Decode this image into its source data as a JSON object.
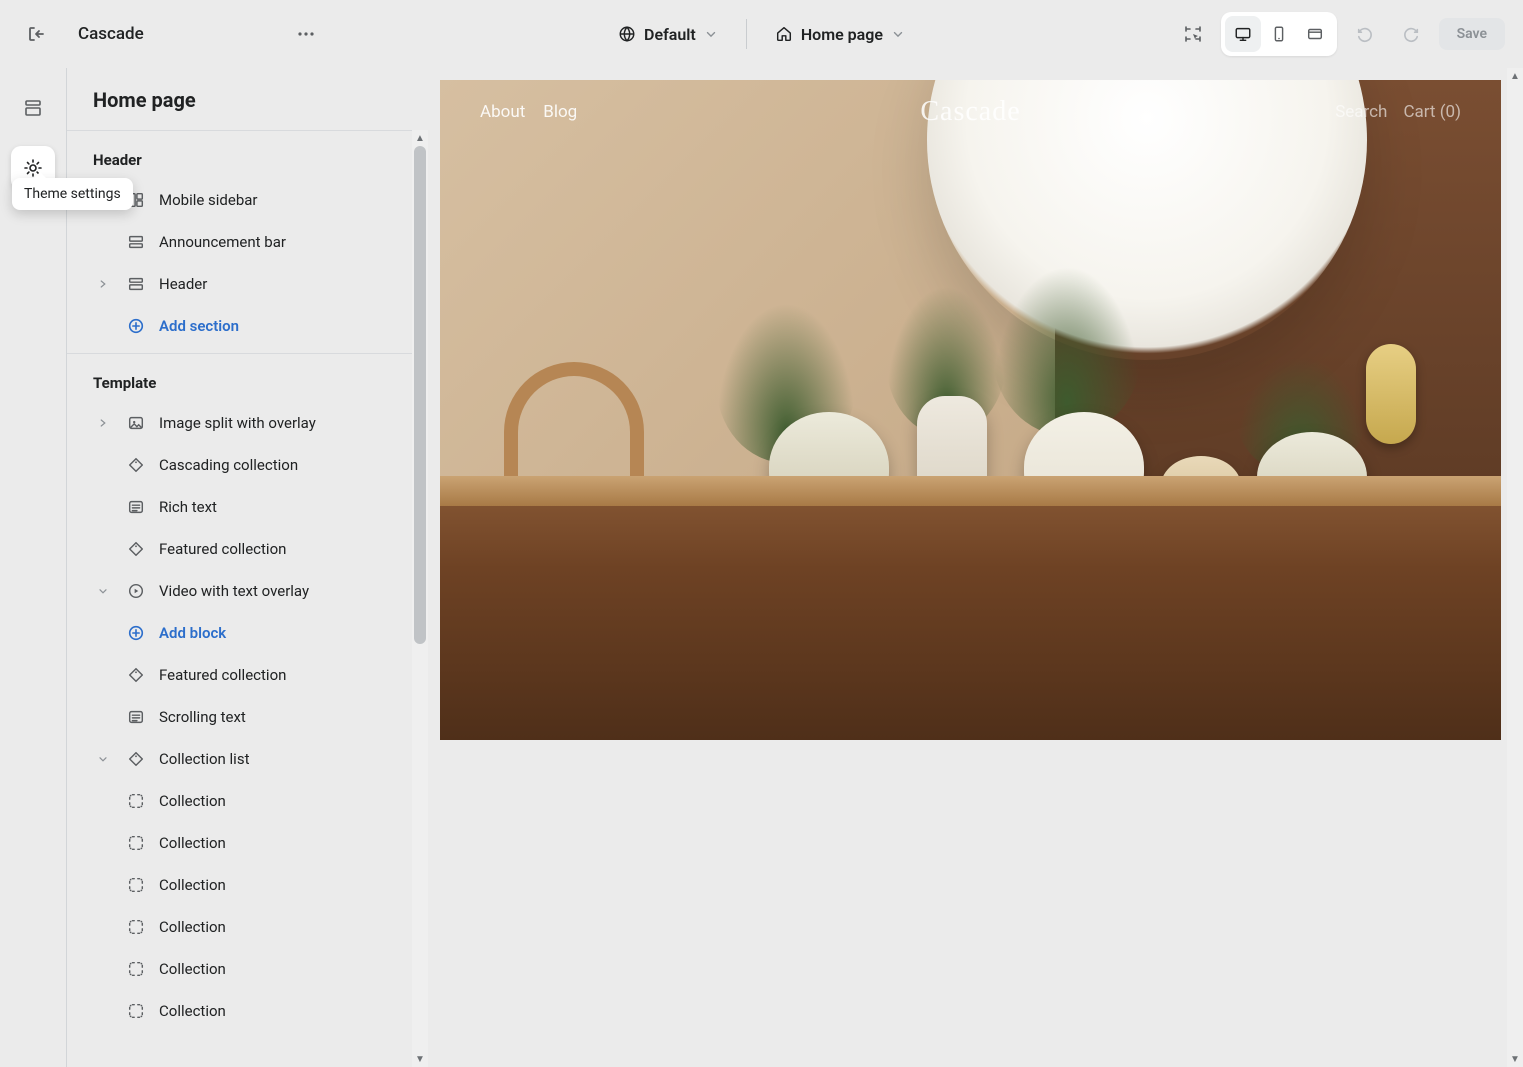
{
  "topbar": {
    "theme_name": "Cascade",
    "locale_label": "Default",
    "page_label": "Home page",
    "save_label": "Save"
  },
  "tooltip": {
    "theme_settings": "Theme settings"
  },
  "sidebar": {
    "title": "Home page",
    "groups": [
      {
        "heading": "Header",
        "rows": [
          {
            "label": "Mobile sidebar",
            "icon": "layout",
            "chevron": "none",
            "indent": false
          },
          {
            "label": "Announcement bar",
            "icon": "announcement",
            "chevron": "none",
            "indent": false
          },
          {
            "label": "Header",
            "icon": "header",
            "chevron": "right",
            "indent": false
          },
          {
            "label": "Add section",
            "icon": "plus-circle",
            "chevron": "none",
            "indent": false,
            "add": true
          }
        ]
      },
      {
        "heading": "Template",
        "rows": [
          {
            "label": "Image split with overlay",
            "icon": "image",
            "chevron": "right",
            "indent": false
          },
          {
            "label": "Cascading collection",
            "icon": "tag",
            "chevron": "none",
            "indent": false
          },
          {
            "label": "Rich text",
            "icon": "text",
            "chevron": "none",
            "indent": false
          },
          {
            "label": "Featured collection",
            "icon": "tag",
            "chevron": "none",
            "indent": false
          },
          {
            "label": "Video with text overlay",
            "icon": "video",
            "chevron": "down",
            "indent": false
          },
          {
            "label": "Add block",
            "icon": "plus-circle",
            "chevron": "none",
            "indent": true,
            "add": true
          },
          {
            "label": "Featured collection",
            "icon": "tag",
            "chevron": "none",
            "indent": false
          },
          {
            "label": "Scrolling text",
            "icon": "text",
            "chevron": "none",
            "indent": false
          },
          {
            "label": "Collection list",
            "icon": "tag",
            "chevron": "down",
            "indent": false
          },
          {
            "label": "Collection",
            "icon": "block",
            "chevron": "none",
            "indent": true
          },
          {
            "label": "Collection",
            "icon": "block",
            "chevron": "none",
            "indent": true
          },
          {
            "label": "Collection",
            "icon": "block",
            "chevron": "none",
            "indent": true
          },
          {
            "label": "Collection",
            "icon": "block",
            "chevron": "none",
            "indent": true
          },
          {
            "label": "Collection",
            "icon": "block",
            "chevron": "none",
            "indent": true
          },
          {
            "label": "Collection",
            "icon": "block",
            "chevron": "none",
            "indent": true
          }
        ]
      }
    ]
  },
  "preview": {
    "site_logo": "Cascade",
    "nav": [
      "About",
      "Blog"
    ],
    "search_label": "Search",
    "cart_label": "Cart (0)"
  }
}
